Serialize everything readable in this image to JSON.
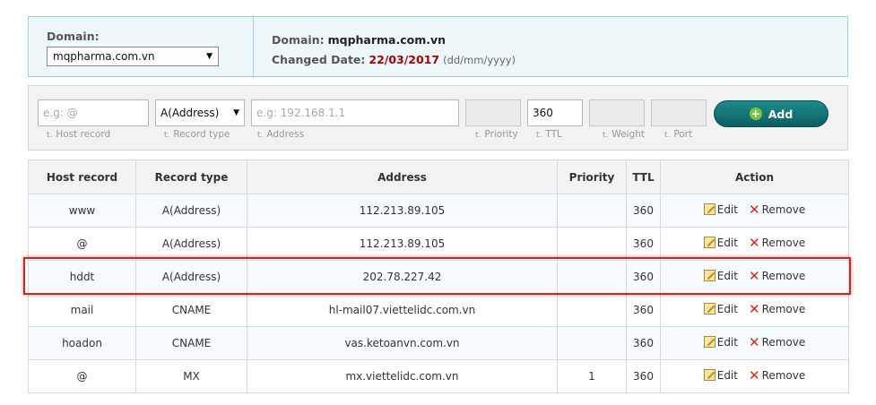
{
  "domain_panel": {
    "domain_label": "Domain:",
    "domain_selected": "mqpharma.com.vn",
    "info_domain_label": "Domain:",
    "info_domain_value": "mqpharma.com.vn",
    "changed_label": "Changed Date:",
    "changed_value": "22/03/2017",
    "date_format_hint": "(dd/mm/yyyy)"
  },
  "form": {
    "host_placeholder": "e.g: @",
    "host_hint": "Host record",
    "type_selected": "A(Address)",
    "type_hint": "Record type",
    "address_placeholder": "e.g: 192.168.1.1",
    "address_hint": "Address",
    "priority_hint": "Priority",
    "ttl_value": "360",
    "ttl_hint": "TTL",
    "weight_hint": "Weight",
    "port_hint": "Port",
    "hint_prefix": "t.",
    "add_label": "Add"
  },
  "table": {
    "headers": {
      "host": "Host record",
      "type": "Record type",
      "address": "Address",
      "priority": "Priority",
      "ttl": "TTL",
      "action": "Action"
    },
    "edit_label": "Edit",
    "remove_label": "Remove",
    "rows": [
      {
        "host": "www",
        "type": "A(Address)",
        "address": "112.213.89.105",
        "priority": "",
        "ttl": "360"
      },
      {
        "host": "@",
        "type": "A(Address)",
        "address": "112.213.89.105",
        "priority": "",
        "ttl": "360"
      },
      {
        "host": "hddt",
        "type": "A(Address)",
        "address": "202.78.227.42",
        "priority": "",
        "ttl": "360"
      },
      {
        "host": "mail",
        "type": "CNAME",
        "address": "hl-mail07.viettelidc.com.vn",
        "priority": "",
        "ttl": "360"
      },
      {
        "host": "hoadon",
        "type": "CNAME",
        "address": "vas.ketoanvn.com.vn",
        "priority": "",
        "ttl": "360"
      },
      {
        "host": "@",
        "type": "MX",
        "address": "mx.viettelidc.com.vn",
        "priority": "1",
        "ttl": "360"
      }
    ]
  },
  "colors": {
    "accent": "#0c5f63",
    "highlight": "#c62828",
    "date": "#b00000"
  }
}
